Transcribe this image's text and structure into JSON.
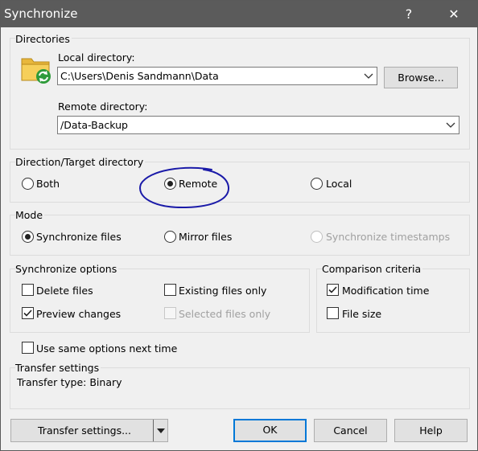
{
  "window": {
    "title": "Synchronize",
    "help_glyph": "?",
    "close_glyph": "✕"
  },
  "directories": {
    "group_label": "Directories",
    "local_label": "Local directory:",
    "local_value": "C:\\Users\\Denis Sandmann\\Data",
    "browse_label": "Browse...",
    "remote_label": "Remote directory:",
    "remote_value": "/Data-Backup"
  },
  "direction": {
    "group_label": "Direction/Target directory",
    "options": [
      "Both",
      "Remote",
      "Local"
    ],
    "selected": "Remote"
  },
  "mode": {
    "group_label": "Mode",
    "options": [
      "Synchronize files",
      "Mirror files",
      "Synchronize timestamps"
    ],
    "selected": "Synchronize files"
  },
  "sync_options": {
    "group_label": "Synchronize options",
    "delete_files": {
      "label": "Delete files",
      "checked": false
    },
    "existing_only": {
      "label": "Existing files only",
      "checked": false
    },
    "preview_changes": {
      "label": "Preview changes",
      "checked": true
    },
    "selected_only": {
      "label": "Selected files only",
      "checked": false,
      "enabled": false
    }
  },
  "comparison": {
    "group_label": "Comparison criteria",
    "modification_time": {
      "label": "Modification time",
      "checked": true
    },
    "file_size": {
      "label": "File size",
      "checked": false
    }
  },
  "use_same": {
    "label": "Use same options next time",
    "checked": false
  },
  "transfer": {
    "group_label": "Transfer settings",
    "type_text": "Transfer type: Binary"
  },
  "buttons": {
    "transfer_settings": "Transfer settings...",
    "ok": "OK",
    "cancel": "Cancel",
    "help": "Help"
  },
  "colors": {
    "annotation": "#1a1aa8",
    "accent": "#0078d7",
    "titlebar": "#5b5b5b"
  }
}
